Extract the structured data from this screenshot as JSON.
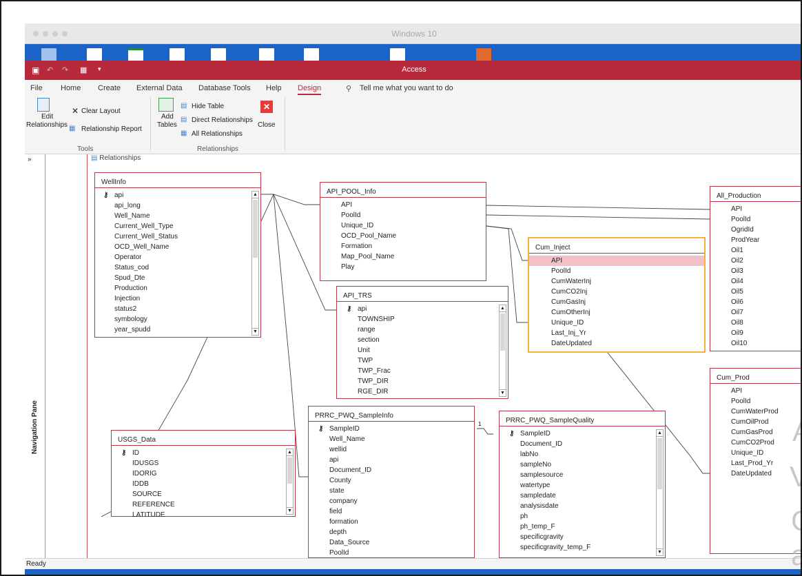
{
  "mac_window": {
    "title": "Windows 10"
  },
  "app": {
    "title": "Access"
  },
  "menu_items": [
    "File",
    "Home",
    "Create",
    "External Data",
    "Database Tools",
    "Help",
    "Design"
  ],
  "tell_me": "Tell me what you want to do",
  "ribbon": {
    "edit_relationships": [
      "Edit",
      "Relationships"
    ],
    "clear_layout": "Clear Layout",
    "relationship_report": "Relationship Report",
    "tools_group": "Tools",
    "add_tables": [
      "Add",
      "Tables"
    ],
    "hide_table": "Hide Table",
    "direct_relationships": "Direct Relationships",
    "all_relationships": "All Relationships",
    "close": "Close",
    "relationships_group": "Relationships"
  },
  "nav_pane": {
    "label": "Navigation Pane",
    "toggle": "»"
  },
  "document_tab": "Relationships",
  "tables": {
    "wellinfo": {
      "title": "WellInfo",
      "fields": [
        "api",
        "api_long",
        "Well_Name",
        "Current_Well_Type",
        "Current_Well_Status",
        "OCD_Well_Name",
        "Operator",
        "Status_cod",
        "Spud_Dte",
        "Production",
        "Injection",
        "status2",
        "symbology",
        "year_spudd"
      ]
    },
    "api_pool_info": {
      "title": "API_POOL_Info",
      "fields": [
        "API",
        "PoolId",
        "Unique_ID",
        "OCD_Pool_Name",
        "Formation",
        "Map_Pool_Name",
        "Play"
      ]
    },
    "all_production": {
      "title": "All_Production",
      "fields": [
        "API",
        "PoolId",
        "OgridId",
        "ProdYear",
        "Oil1",
        "Oil2",
        "Oil3",
        "Oil4",
        "Oil5",
        "Oil6",
        "Oil7",
        "Oil8",
        "Oil9",
        "Oil10"
      ]
    },
    "cum_inject": {
      "title": "Cum_Inject",
      "fields": [
        "API",
        "PoolId",
        "CumWaterInj",
        "CumCO2Inj",
        "CumGasInj",
        "CumOtherInj",
        "Unique_ID",
        "Last_Inj_Yr",
        "DateUpdated"
      ]
    },
    "api_trs": {
      "title": "API_TRS",
      "fields": [
        "api",
        "TOWNSHIP",
        "range",
        "section",
        "Unit",
        "TWP",
        "TWP_Frac",
        "TWP_DIR",
        "RGE_DIR"
      ]
    },
    "cum_prod": {
      "title": "Cum_Prod",
      "fields": [
        "API",
        "PoolId",
        "CumWaterProd",
        "CumOilProd",
        "CumGasProd",
        "CumCO2Prod",
        "Unique_ID",
        "Last_Prod_Yr",
        "DateUpdated"
      ]
    },
    "usgs_data": {
      "title": "USGS_Data",
      "fields": [
        "ID",
        "IDUSGS",
        "IDORIG",
        "IDDB",
        "SOURCE",
        "REFERENCE",
        "LATITUDE"
      ]
    },
    "sampleinfo": {
      "title": "PRRC_PWQ_SampleInfo",
      "fields": [
        "SampleID",
        "Well_Name",
        "wellid",
        "api",
        "Document_ID",
        "County",
        "state",
        "company",
        "field",
        "formation",
        "depth",
        "Data_Source",
        "PoolId"
      ]
    },
    "samplequality": {
      "title": "PRRC_PWQ_SampleQuality",
      "fields": [
        "SampleID",
        "Document_ID",
        "labNo",
        "sampleNo",
        "samplesource",
        "watertype",
        "sampledate",
        "analysisdate",
        "ph",
        "ph_temp_F",
        "specificgravity",
        "specificgravity_temp_F"
      ]
    }
  },
  "relationship_labels": {
    "one_side": "1"
  },
  "status_bar": "Ready",
  "watermark": [
    "A",
    "V",
    "G",
    "a"
  ]
}
